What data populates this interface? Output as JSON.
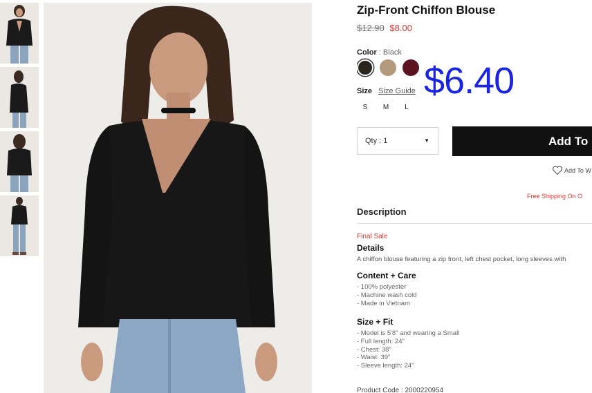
{
  "product": {
    "title": "Zip-Front Chiffon Blouse",
    "original_price": "$12.90",
    "sale_price": "$8.00",
    "promo_price": "$6.40"
  },
  "color": {
    "label": "Color",
    "separator": ":",
    "selected": "Black",
    "swatches": [
      {
        "name": "Black",
        "hex": "#2b2520"
      },
      {
        "name": "Taupe",
        "hex": "#b49a7c"
      },
      {
        "name": "Burgundy",
        "hex": "#5b1322"
      }
    ]
  },
  "size": {
    "label": "Size",
    "guide_link": "Size Guide",
    "options": [
      "S",
      "M",
      "L"
    ]
  },
  "purchase": {
    "qty_label": "Qty : 1",
    "add_button": "Add To",
    "wishlist": "Add To W",
    "shipping": "Free Shipping On O"
  },
  "description": {
    "heading": "Description",
    "final_sale": "Final Sale",
    "details_title": "Details",
    "details_text": "A chiffon blouse featuring a zip front, left chest pocket, long sleeves with",
    "content_title": "Content + Care",
    "content_items": [
      "- 100% polyester",
      "- Machine wash cold",
      "- Made in Vietnam"
    ],
    "fit_title": "Size + Fit",
    "fit_items": [
      "- Model is 5'8\" and wearing a Small",
      "- Full length: 24\"",
      "- Chest: 38\"",
      "- Waist: 39\"",
      "- Sleeve length: 24\""
    ],
    "product_code": "Product Code : 2000220954"
  },
  "colors": {
    "sale_red": "#e2342f",
    "promo_blue": "#1a25e0",
    "button_black": "#111111"
  }
}
